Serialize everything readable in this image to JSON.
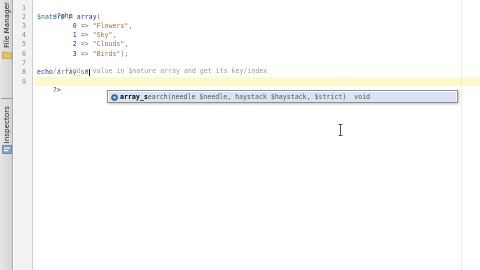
{
  "dock": {
    "tab_file_manager": "File Manager",
    "tab_inspectors": "Inspectors"
  },
  "gutter": {
    "line_numbers": [
      "1",
      "2",
      "3",
      "4",
      "5",
      "6",
      "7",
      "8",
      "9"
    ]
  },
  "code": {
    "l1": "<?php",
    "l2_var": "$nature",
    "l2_op": " = ",
    "l2_fn": "array",
    "l2_paren": "(",
    "l3_indent": "         ",
    "l3_key": "0",
    "l3_arrow": " => ",
    "l3_val": "\"Flowers\"",
    "l3_end": ",",
    "l4_key": "1",
    "l4_val": "\"Sky\"",
    "l4_end": ",",
    "l5_key": "2",
    "l5_val": "\"Clouds\"",
    "l5_end": ",",
    "l6_key": "3",
    "l6_val": "\"Birds\"",
    "l6_end": ");",
    "l7_comment": "// find a value in $nature array and get its key/index",
    "l8_echo": "echo",
    "l8_typed": " array_se",
    "l9": "?>"
  },
  "autocomplete": {
    "match_prefix": "array_s",
    "match_rest": "earch",
    "signature": "(needle $needle, haystack $haystack, $strict)",
    "return_type": "void"
  },
  "colors": {
    "current_line": "#fff8c8",
    "selection": "#d8e4f4",
    "string": "#b06d2f",
    "number": "#2f2fb4"
  }
}
